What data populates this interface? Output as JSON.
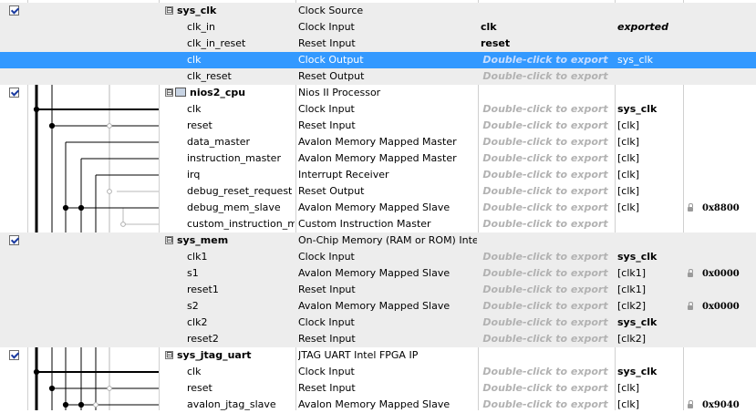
{
  "hint_text": "Double-click to export",
  "rows": [
    {
      "type": "component",
      "checked": true,
      "expander": "⊟",
      "name": "sys_clk",
      "description": "Clock Source",
      "export": "",
      "clock": "",
      "base": ""
    },
    {
      "type": "port",
      "name": "clk_in",
      "description": "Clock Input",
      "export": "clk",
      "export_style": "value",
      "clock": "exported",
      "clock_style": "italic",
      "base": ""
    },
    {
      "type": "port",
      "name": "clk_in_reset",
      "description": "Reset Input",
      "export": "reset",
      "export_style": "value",
      "clock": "",
      "base": ""
    },
    {
      "type": "port",
      "selected": true,
      "name": "clk",
      "description": "Clock Output",
      "export_style": "hint",
      "clock": "sys_clk",
      "base": ""
    },
    {
      "type": "port",
      "name": "clk_reset",
      "description": "Reset Output",
      "export_style": "hint",
      "clock": "",
      "base": ""
    },
    {
      "type": "component",
      "checked": true,
      "expander": "⊟",
      "icon": "cpu-icon",
      "name": "nios2_cpu",
      "description": "Nios II Processor",
      "clock": "",
      "base": ""
    },
    {
      "type": "port",
      "name": "clk",
      "description": "Clock Input",
      "export_style": "hint",
      "clock": "sys_clk",
      "clock_style": "bold",
      "base": ""
    },
    {
      "type": "port",
      "name": "reset",
      "description": "Reset Input",
      "export_style": "hint",
      "clock": "[clk]",
      "base": ""
    },
    {
      "type": "port",
      "name": "data_master",
      "description": "Avalon Memory Mapped Master",
      "export_style": "hint",
      "clock": "[clk]",
      "base": ""
    },
    {
      "type": "port",
      "name": "instruction_master",
      "description": "Avalon Memory Mapped Master",
      "export_style": "hint",
      "clock": "[clk]",
      "base": ""
    },
    {
      "type": "port",
      "name": "irq",
      "description": "Interrupt Receiver",
      "export_style": "hint",
      "clock": "[clk]",
      "base": ""
    },
    {
      "type": "port",
      "name": "debug_reset_request",
      "description": "Reset Output",
      "export_style": "hint",
      "clock": "[clk]",
      "base": ""
    },
    {
      "type": "port",
      "name": "debug_mem_slave",
      "description": "Avalon Memory Mapped Slave",
      "export_style": "hint",
      "clock": "[clk]",
      "base": "0x8800",
      "locked": true
    },
    {
      "type": "port",
      "name": "custom_instruction_m...",
      "description": "Custom Instruction Master",
      "export_style": "hint",
      "clock": "",
      "base": ""
    },
    {
      "type": "component",
      "checked": true,
      "expander": "⊟",
      "name": "sys_mem",
      "description": "On-Chip Memory (RAM or ROM) Intel ...",
      "clock": "",
      "base": ""
    },
    {
      "type": "port",
      "name": "clk1",
      "description": "Clock Input",
      "export_style": "hint",
      "clock": "sys_clk",
      "clock_style": "bold",
      "base": ""
    },
    {
      "type": "port",
      "name": "s1",
      "description": "Avalon Memory Mapped Slave",
      "export_style": "hint",
      "clock": "[clk1]",
      "base": "0x0000",
      "locked": true
    },
    {
      "type": "port",
      "name": "reset1",
      "description": "Reset Input",
      "export_style": "hint",
      "clock": "[clk1]",
      "base": ""
    },
    {
      "type": "port",
      "name": "s2",
      "description": "Avalon Memory Mapped Slave",
      "export_style": "hint",
      "clock": "[clk2]",
      "base": "0x0000",
      "locked": true
    },
    {
      "type": "port",
      "name": "clk2",
      "description": "Clock Input",
      "export_style": "hint",
      "clock": "sys_clk",
      "clock_style": "bold",
      "base": ""
    },
    {
      "type": "port",
      "name": "reset2",
      "description": "Reset Input",
      "export_style": "hint",
      "clock": "[clk2]",
      "base": ""
    },
    {
      "type": "component",
      "checked": true,
      "expander": "⊟",
      "name": "sys_jtag_uart",
      "description": "JTAG UART Intel FPGA IP",
      "clock": "",
      "base": ""
    },
    {
      "type": "port",
      "name": "clk",
      "description": "Clock Input",
      "export_style": "hint",
      "clock": "sys_clk",
      "clock_style": "bold",
      "base": ""
    },
    {
      "type": "port",
      "name": "reset",
      "description": "Reset Input",
      "export_style": "hint",
      "clock": "[clk]",
      "base": ""
    },
    {
      "type": "port",
      "name": "avalon_jtag_slave",
      "description": "Avalon Memory Mapped Slave",
      "export_style": "hint",
      "clock": "[clk]",
      "base": "0x9040",
      "locked": true
    }
  ]
}
